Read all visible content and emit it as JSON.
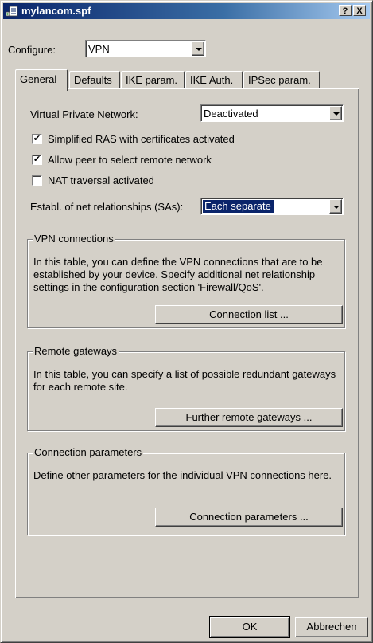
{
  "window": {
    "title": "mylancom.spf",
    "help_button": "?",
    "close_button": "X"
  },
  "configure": {
    "label": "Configure:",
    "value": "VPN"
  },
  "tabs": [
    {
      "label": "General",
      "active": true
    },
    {
      "label": "Defaults"
    },
    {
      "label": "IKE param."
    },
    {
      "label": "IKE Auth."
    },
    {
      "label": "IPSec param."
    }
  ],
  "general": {
    "vpn_label": "Virtual Private Network:",
    "vpn_value": "Deactivated",
    "checkboxes": [
      {
        "label": "Simplified RAS with certificates activated",
        "checked": true
      },
      {
        "label": "Allow peer to select remote network",
        "checked": true
      },
      {
        "label": "NAT traversal activated",
        "checked": false
      }
    ],
    "sa_label": "Establ. of net relationships (SAs):",
    "sa_value": "Each separate"
  },
  "groups": {
    "vpn_connections": {
      "title": "VPN connections",
      "description": "In this table, you can define the VPN connections that are to be established by your device. Specify additional net relationship settings in the configuration section 'Firewall/QoS'.",
      "button": "Connection list ..."
    },
    "remote_gateways": {
      "title": "Remote gateways",
      "description": "In this table, you can specify a list of possible redundant gateways for each remote site.",
      "button": "Further remote gateways ..."
    },
    "connection_parameters": {
      "title": "Connection parameters",
      "description": "Define other parameters for the individual VPN connections here.",
      "button": "Connection parameters ..."
    }
  },
  "footer": {
    "ok": "OK",
    "cancel": "Abbrechen"
  },
  "colors": {
    "titlebar_start": "#0a246a",
    "titlebar_end": "#a6caf0",
    "face": "#d4d0c8",
    "selection": "#0a246a"
  }
}
